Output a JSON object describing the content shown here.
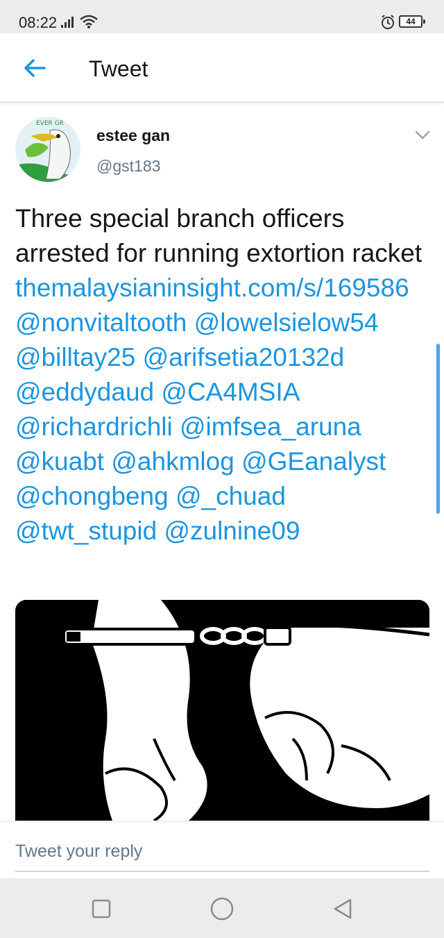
{
  "status_bar": {
    "time": "08:22",
    "battery": "44",
    "icons": [
      "signal-icon",
      "wifi-icon",
      "alarm-icon",
      "battery-icon"
    ]
  },
  "header": {
    "title": "Tweet",
    "back_icon": "back-arrow-icon"
  },
  "tweet": {
    "author_name": "estee gan",
    "author_handle": "@gst183",
    "text": "Three special branch officers arrested for running extortion racket ",
    "link": "themalaysianinsight.com/s/169586",
    "mentions": [
      "@nonvitaltooth",
      "@lowelsielow54",
      "@billtay25",
      "@arifsetia20132d",
      "@eddydaud",
      "@CA4MSIA",
      "@richardrichli",
      "@imfsea_aruna",
      "@kuabt",
      "@ahkmlog",
      "@GEanalyst",
      "@chongbeng",
      "@_chuad",
      "@twt_stupid",
      "@zulnine09"
    ],
    "media_icon": "handcuffs-image"
  },
  "reply": {
    "placeholder": "Tweet your reply"
  },
  "colors": {
    "accent": "#1b95e0",
    "text": "#14171a",
    "secondary": "#657786"
  },
  "nav": {
    "icons": [
      "recent-apps-icon",
      "home-icon",
      "back-icon"
    ]
  }
}
